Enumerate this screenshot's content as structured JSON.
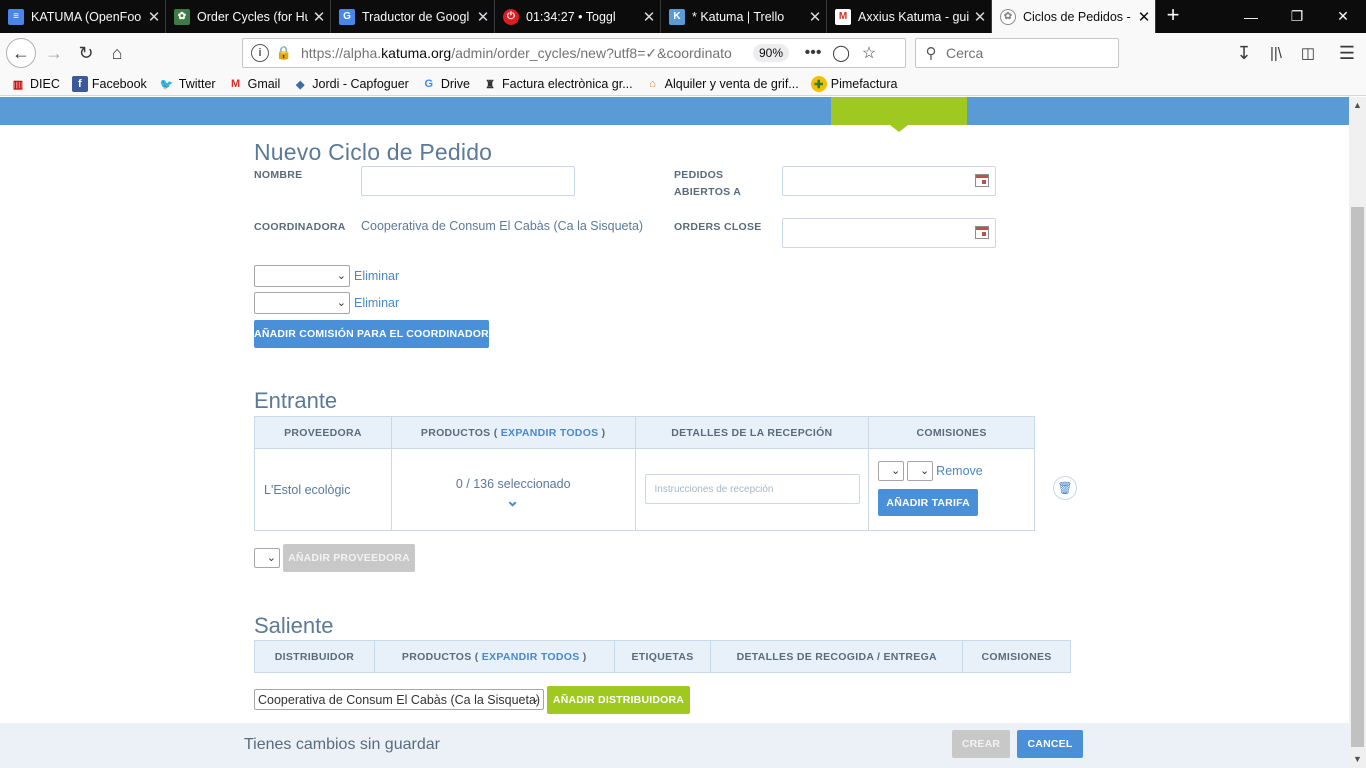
{
  "browser": {
    "tabs": [
      {
        "title": "KATUMA (OpenFoo",
        "icon": "document-icon",
        "color": "#4a86e8",
        "glyph": "≡"
      },
      {
        "title": "Order Cycles (for Hu",
        "icon": "globe-icon",
        "color": "#3d7a44",
        "glyph": "✿"
      },
      {
        "title": "Traductor de Googl",
        "icon": "google-translate-icon",
        "color": "#4a86e8",
        "glyph": "G"
      },
      {
        "title": "01:34:27 • Toggl",
        "icon": "toggl-icon",
        "color": "#e01b22",
        "glyph": "⏻"
      },
      {
        "title": "* Katuma | Trello",
        "icon": "katuma-icon",
        "color": "#5b9bd5",
        "glyph": "K"
      },
      {
        "title": "Axxius Katuma - gui",
        "icon": "gmail-icon",
        "color": "#d93025",
        "glyph": "M"
      },
      {
        "title": "Ciclos de Pedidos -",
        "icon": "katuma-logo-icon",
        "color": "#8a8a8a",
        "glyph": "✿"
      }
    ],
    "close_glyph": "✕",
    "newtab_glyph": "+",
    "url_scheme": "https://alpha.",
    "url_domain": "katuma.org",
    "url_path": "/admin/order_cycles/new?utf8=✓&coordinato",
    "zoom": "90%",
    "search_placeholder": "Cerca",
    "bookmarks": [
      {
        "label": "DIEC",
        "icon": "diec-icon",
        "color": "#c00000",
        "glyph": "▥"
      },
      {
        "label": "Facebook",
        "icon": "facebook-icon",
        "color": "#3b5998",
        "glyph": "f"
      },
      {
        "label": "Twitter",
        "icon": "twitter-icon",
        "color": "#1da1f2",
        "glyph": "🐦"
      },
      {
        "label": "Gmail",
        "icon": "gmail-icon",
        "color": "#d93025",
        "glyph": "M"
      },
      {
        "label": "Jordi - Capfoguer",
        "icon": "capfoguer-icon",
        "color": "#3b6ea5",
        "glyph": "◆"
      },
      {
        "label": "Drive",
        "icon": "google-icon",
        "color": "#4285f4",
        "glyph": "G"
      },
      {
        "label": "Factura electrònica gr...",
        "icon": "factura-icon",
        "color": "#333333",
        "glyph": "♜"
      },
      {
        "label": "Alquiler y venta de grif...",
        "icon": "alquiler-icon",
        "color": "#e67e22",
        "glyph": "⌂"
      },
      {
        "label": "Pimefactura",
        "icon": "pimefactura-icon",
        "color": "#2e7d32",
        "glyph": "✚"
      }
    ]
  },
  "form": {
    "title": "Nuevo Ciclo de Pedido",
    "name_label": "NOMBRE",
    "opens_label_1": "PEDIDOS",
    "opens_label_2": "ABIERTOS A",
    "coordinator_label": "COORDINADORA",
    "coordinator_value": "Cooperativa de Consum El Cabàs (Ca la Sisqueta)",
    "closes_label": "ORDERS CLOSE",
    "remove_link": "Eliminar",
    "add_fee_button": "AÑADIR COMISIÓN PARA EL COORDINADOR"
  },
  "incoming": {
    "title": "Entrante",
    "headers": {
      "supplier": "PROVEEDORA",
      "products_prefix": "PRODUCTOS ( ",
      "expand_all": "EXPANDIR TODOS",
      "products_suffix": " )",
      "receival": "DETALLES DE LA RECEPCIÓN",
      "fees": "COMISIONES"
    },
    "row": {
      "supplier": "L'Estol ecològic",
      "products": "0 / 136 seleccionado",
      "receival_placeholder": "Instrucciones de recepción",
      "remove": "Remove",
      "add_fee": "AÑADIR TARIFA"
    },
    "add_supplier": "AÑADIR PROVEEDORA"
  },
  "outgoing": {
    "title": "Saliente",
    "headers": {
      "distributor": "DISTRIBUIDOR",
      "products_prefix": "PRODUCTOS ( ",
      "expand_all": "EXPANDIR TODOS",
      "products_suffix": " )",
      "tags": "ETIQUETAS",
      "pickup": "DETALLES DE RECOGIDA / ENTREGA",
      "fees": "COMISIONES"
    },
    "distributor_selected": "Cooperativa de Consum El Cabàs (Ca la Sisqueta)",
    "add_distributor": "AÑADIR DISTRIBUIDORA"
  },
  "footer": {
    "message": "Tienes cambios sin guardar",
    "create": "CREAR",
    "cancel": "CANCEL"
  },
  "colors": {
    "admin_nav": "#5b9bd5",
    "admin_nav_active": "#9fc820",
    "primary_button": "#4a90d9",
    "accent_button": "#9fc820"
  }
}
